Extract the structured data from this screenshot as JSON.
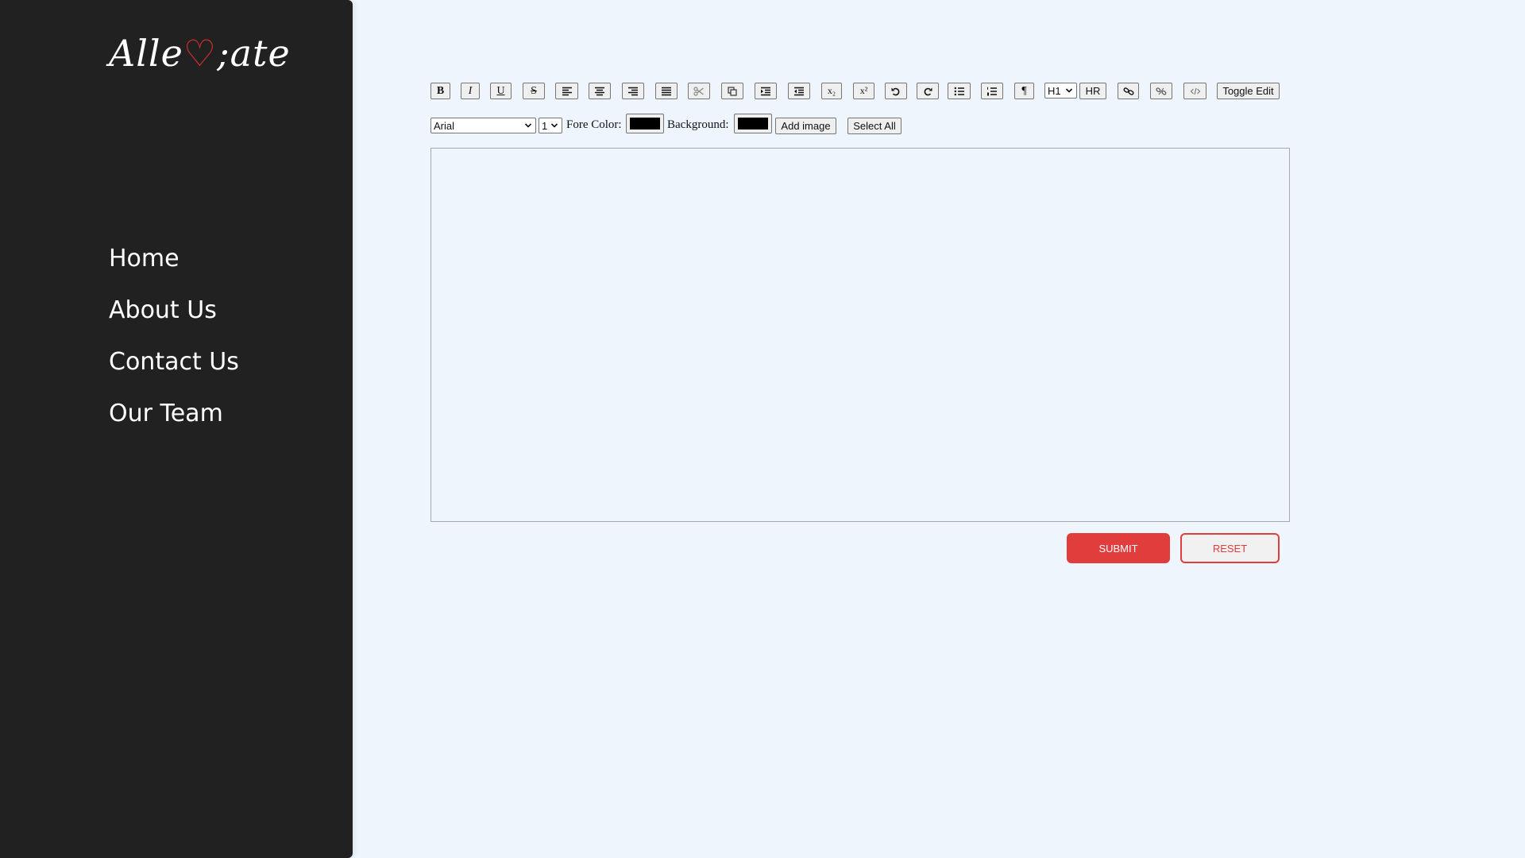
{
  "sidebar": {
    "logo": {
      "part1": "Alle",
      "heart": "♡",
      "part2": ";ate"
    },
    "nav": [
      {
        "label": "Home"
      },
      {
        "label": "About Us"
      },
      {
        "label": "Contact Us"
      },
      {
        "label": "Our Team"
      }
    ]
  },
  "toolbar": {
    "bold": "B",
    "italic": "I",
    "underline": "U",
    "strike": "S",
    "subscript": "x₂",
    "superscript": "x²",
    "paragraph": "¶",
    "heading_value": "H1",
    "hr": "HR",
    "toggle_edit": "Toggle Edit",
    "icons": [
      "align-left-icon",
      "align-center-icon",
      "align-right-icon",
      "align-justify-icon",
      "cut-icon",
      "copy-icon",
      "indent-icon",
      "outdent-icon",
      "undo-icon",
      "redo-icon",
      "bullet-list-icon",
      "numbered-list-icon",
      "link-icon",
      "unlink-icon",
      "code-icon"
    ]
  },
  "format_bar": {
    "font_value": "Arial",
    "size_value": "1",
    "fore_color_label": "Fore Color:",
    "fore_color_value": "#000000",
    "background_label": "Background:",
    "background_value": "#000000",
    "add_image": "Add image",
    "select_all": "Select All"
  },
  "editor": {
    "content": ""
  },
  "actions": {
    "submit": "SUBMIT",
    "reset": "RESET"
  },
  "colors": {
    "sidebar": "#212121",
    "page": "#eef5fd",
    "accent": "#e13d3d"
  }
}
